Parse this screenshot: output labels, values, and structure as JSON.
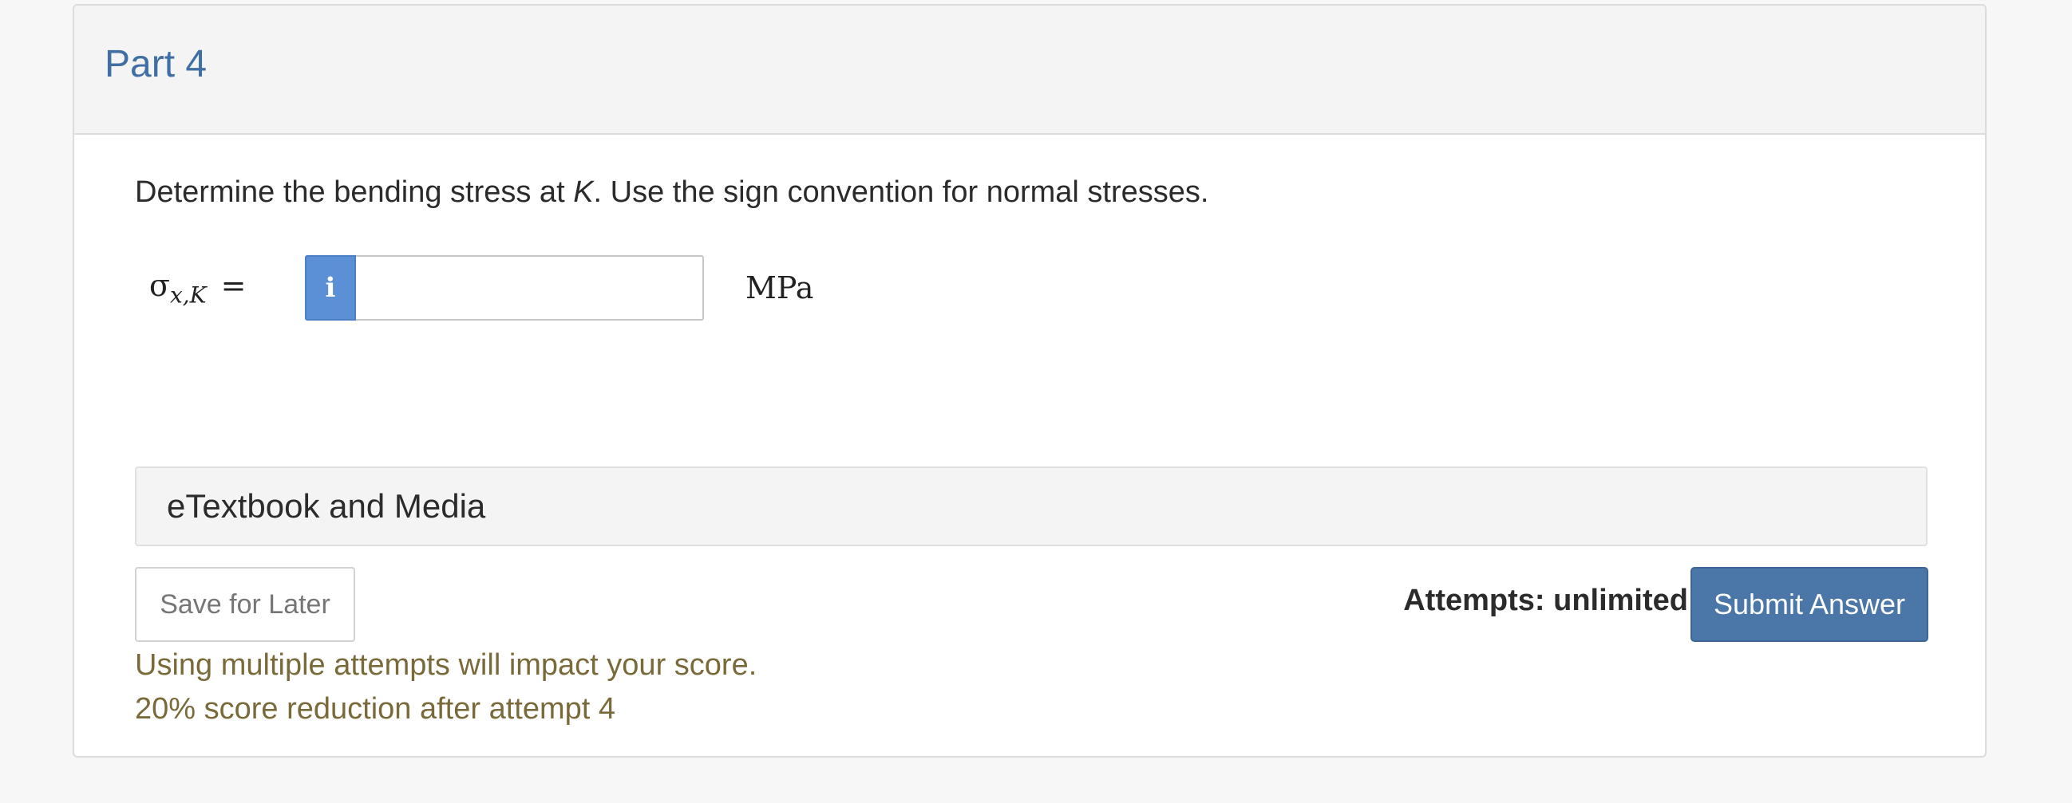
{
  "part": {
    "title": "Part 4"
  },
  "question": {
    "prefix": "Determine the bending stress at ",
    "variable": "K",
    "suffix": ". Use the sign convention for normal stresses."
  },
  "answer": {
    "symbol": "σ",
    "subscript": "x,K",
    "equals": "=",
    "info_glyph": "i",
    "value": "",
    "unit": "MPa"
  },
  "etextbook": {
    "label": "eTextbook and Media"
  },
  "actions": {
    "save_label": "Save for Later",
    "attempts_label": "Attempts: unlimited",
    "submit_label": "Submit Answer"
  },
  "notices": {
    "line1": "Using multiple attempts will impact your score.",
    "line2": "20% score reduction after attempt 4"
  },
  "colors": {
    "title": "#3f6fa5",
    "info_button": "#5b8fd6",
    "submit_button": "#4b76a8",
    "notice_text": "#7a6a3a"
  }
}
